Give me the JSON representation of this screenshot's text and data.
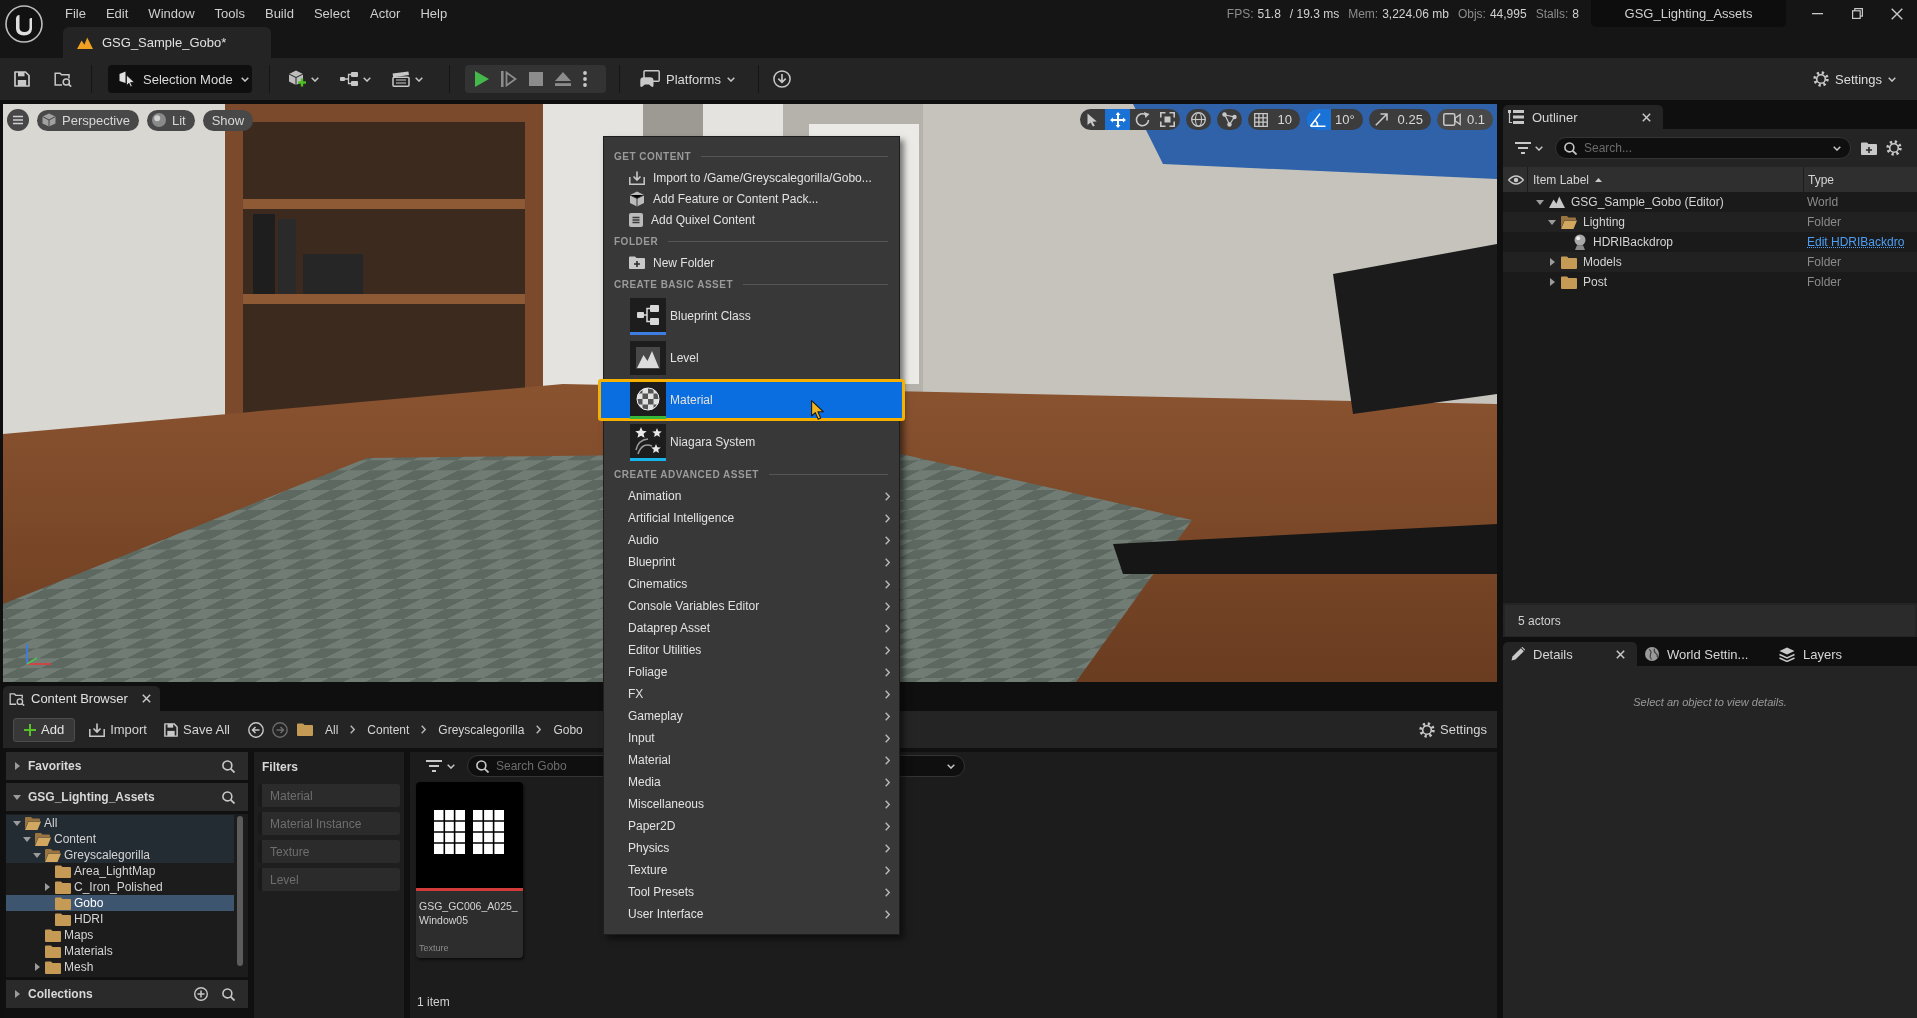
{
  "menu_bar": {
    "items": [
      "File",
      "Edit",
      "Window",
      "Tools",
      "Build",
      "Select",
      "Actor",
      "Help"
    ]
  },
  "level_tab": {
    "title": "GSG_Sample_Gobo*"
  },
  "stats": [
    {
      "label": "FPS:",
      "value": "51.8"
    },
    {
      "value": "/ 19.3 ms"
    },
    {
      "label": "Mem:",
      "value": "3,224.06 mb"
    },
    {
      "label": "Objs:",
      "value": "44,995"
    },
    {
      "label": "Stalls:",
      "value": "8"
    }
  ],
  "project": {
    "name": "GSG_Lighting_Assets"
  },
  "toolbar": {
    "mode_button": "Selection Mode",
    "platforms_button": "Platforms",
    "settings_button": "Settings"
  },
  "viewport": {
    "view_buttons": [
      "Perspective",
      "Lit",
      "Show"
    ],
    "transform_tools": [
      {
        "kind": "select",
        "selected": false
      },
      {
        "kind": "move",
        "selected": true
      },
      {
        "kind": "rotate",
        "selected": false
      },
      {
        "kind": "scale",
        "selected": false
      }
    ],
    "snaps": [
      {
        "kind": "grid",
        "value": "10",
        "on": false
      },
      {
        "kind": "angle",
        "value": "10°",
        "on": true
      },
      {
        "kind": "scale",
        "value": "0.25",
        "on": false
      }
    ],
    "camera_speed": "0.1"
  },
  "context_menu": {
    "sections": [
      {
        "heading": "GET CONTENT",
        "items": [
          {
            "kind": "action",
            "label": "Import to /Game/Greyscalegorilla/Gobo...",
            "selected": false
          },
          {
            "kind": "action",
            "label": "Add Feature or Content Pack...",
            "selected": false
          },
          {
            "kind": "action",
            "label": "Add Quixel Content",
            "selected": false
          }
        ]
      },
      {
        "heading": "FOLDER",
        "items": [
          {
            "kind": "action",
            "label": "New Folder",
            "selected": false
          }
        ]
      },
      {
        "heading": "CREATE BASIC ASSET",
        "items": [
          {
            "kind": "asset",
            "label": "Blueprint Class",
            "color": "#3b7de0",
            "selected": false
          },
          {
            "kind": "asset",
            "label": "Level",
            "selected": false
          },
          {
            "kind": "asset",
            "label": "Material",
            "color": "#35b83a",
            "selected": true
          },
          {
            "kind": "asset",
            "label": "Niagara System",
            "color": "#19b4e8",
            "selected": false
          }
        ]
      },
      {
        "heading": "CREATE ADVANCED ASSET",
        "items": [
          {
            "kind": "submenu",
            "label": "Animation",
            "selected": false
          },
          {
            "kind": "submenu",
            "label": "Artificial Intelligence",
            "selected": false
          },
          {
            "kind": "submenu",
            "label": "Audio",
            "selected": false
          },
          {
            "kind": "submenu",
            "label": "Blueprint",
            "selected": false
          },
          {
            "kind": "submenu",
            "label": "Cinematics",
            "selected": false
          },
          {
            "kind": "submenu",
            "label": "Console Variables Editor",
            "selected": false
          },
          {
            "kind": "submenu",
            "label": "Dataprep Asset",
            "selected": false
          },
          {
            "kind": "submenu",
            "label": "Editor Utilities",
            "selected": false
          },
          {
            "kind": "submenu",
            "label": "Foliage",
            "selected": false
          },
          {
            "kind": "submenu",
            "label": "FX",
            "selected": false
          },
          {
            "kind": "submenu",
            "label": "Gameplay",
            "selected": false
          },
          {
            "kind": "submenu",
            "label": "Input",
            "selected": false
          },
          {
            "kind": "submenu",
            "label": "Material",
            "selected": false
          },
          {
            "kind": "submenu",
            "label": "Media",
            "selected": false
          },
          {
            "kind": "submenu",
            "label": "Miscellaneous",
            "selected": false
          },
          {
            "kind": "submenu",
            "label": "Paper2D",
            "selected": false
          },
          {
            "kind": "submenu",
            "label": "Physics",
            "selected": false
          },
          {
            "kind": "submenu",
            "label": "Texture",
            "selected": false
          },
          {
            "kind": "submenu",
            "label": "Tool Presets",
            "selected": false
          },
          {
            "kind": "submenu",
            "label": "User Interface",
            "selected": false
          }
        ]
      }
    ]
  },
  "outliner": {
    "tab": {
      "label": "Outliner",
      "closable": true
    },
    "search_placeholder": "Search...",
    "columns": [
      "Item Label",
      "Type"
    ],
    "rows": [
      {
        "label": "GSG_Sample_Gobo (Editor)",
        "type": "World",
        "kind": "world",
        "expanded": true,
        "selected": false,
        "children": [
          {
            "label": "Lighting",
            "type": "Folder",
            "kind": "folder",
            "expanded": true,
            "selected": false,
            "children": [
              {
                "label": "HDRIBackdrop",
                "link": "Edit HDRIBackdro",
                "kind": "actor",
                "selected": false
              }
            ]
          },
          {
            "label": "Models",
            "type": "Folder",
            "kind": "folder",
            "expanded": false,
            "selected": false
          },
          {
            "label": "Post",
            "type": "Folder",
            "kind": "folder",
            "expanded": false,
            "selected": false
          }
        ]
      }
    ],
    "status": "5 actors"
  },
  "details": {
    "tabs": [
      {
        "label": "Details",
        "selected": true,
        "closable": true
      },
      {
        "label": "World Settin...",
        "selected": false,
        "closable": false
      },
      {
        "label": "Layers",
        "selected": false,
        "closable": false
      }
    ],
    "message": "Select an object to view details."
  },
  "content_browser": {
    "tab": {
      "label": "Content Browser",
      "closable": true
    },
    "add_button": "Add",
    "import_button": "Import",
    "save_all_button": "Save All",
    "breadcrumb": [
      "All",
      "Content",
      "Greyscalegorilla",
      "Gobo"
    ],
    "settings_button": "Settings",
    "sources": [
      {
        "title": "Favorites",
        "expanded": false
      },
      {
        "title": "GSG_Lighting_Assets",
        "expanded": true
      }
    ],
    "tree": [
      {
        "label": "All",
        "expanded": true,
        "selected": false,
        "children": [
          {
            "label": "Content",
            "expanded": true,
            "selected": false,
            "children": [
              {
                "label": "Greyscalegorilla",
                "expanded": true,
                "selected": false,
                "children": [
                  {
                    "label": "Area_LightMap",
                    "selected": false
                  },
                  {
                    "label": "C_Iron_Polished",
                    "expanded": false,
                    "selected": false
                  },
                  {
                    "label": "Gobo",
                    "selected": true
                  },
                  {
                    "label": "HDRI",
                    "selected": false
                  }
                ]
              },
              {
                "label": "Maps",
                "selected": false
              },
              {
                "label": "Materials",
                "selected": false
              },
              {
                "label": "Mesh",
                "expanded": false,
                "selected": false
              }
            ]
          }
        ]
      }
    ],
    "collections": {
      "title": "Collections",
      "expanded": false
    },
    "filters": {
      "title": "Filters",
      "items": [
        {
          "label": "Material",
          "checked": false
        },
        {
          "label": "Material Instance",
          "checked": false
        },
        {
          "label": "Texture",
          "checked": false
        },
        {
          "label": "Level",
          "checked": false
        }
      ]
    },
    "search_placeholder": "Search Gobo",
    "assets": [
      {
        "name": "GSG_GC006_A025_Window05",
        "type": "Texture",
        "color": "#d33a3a",
        "selected": false
      }
    ],
    "item_count": "1 item"
  }
}
